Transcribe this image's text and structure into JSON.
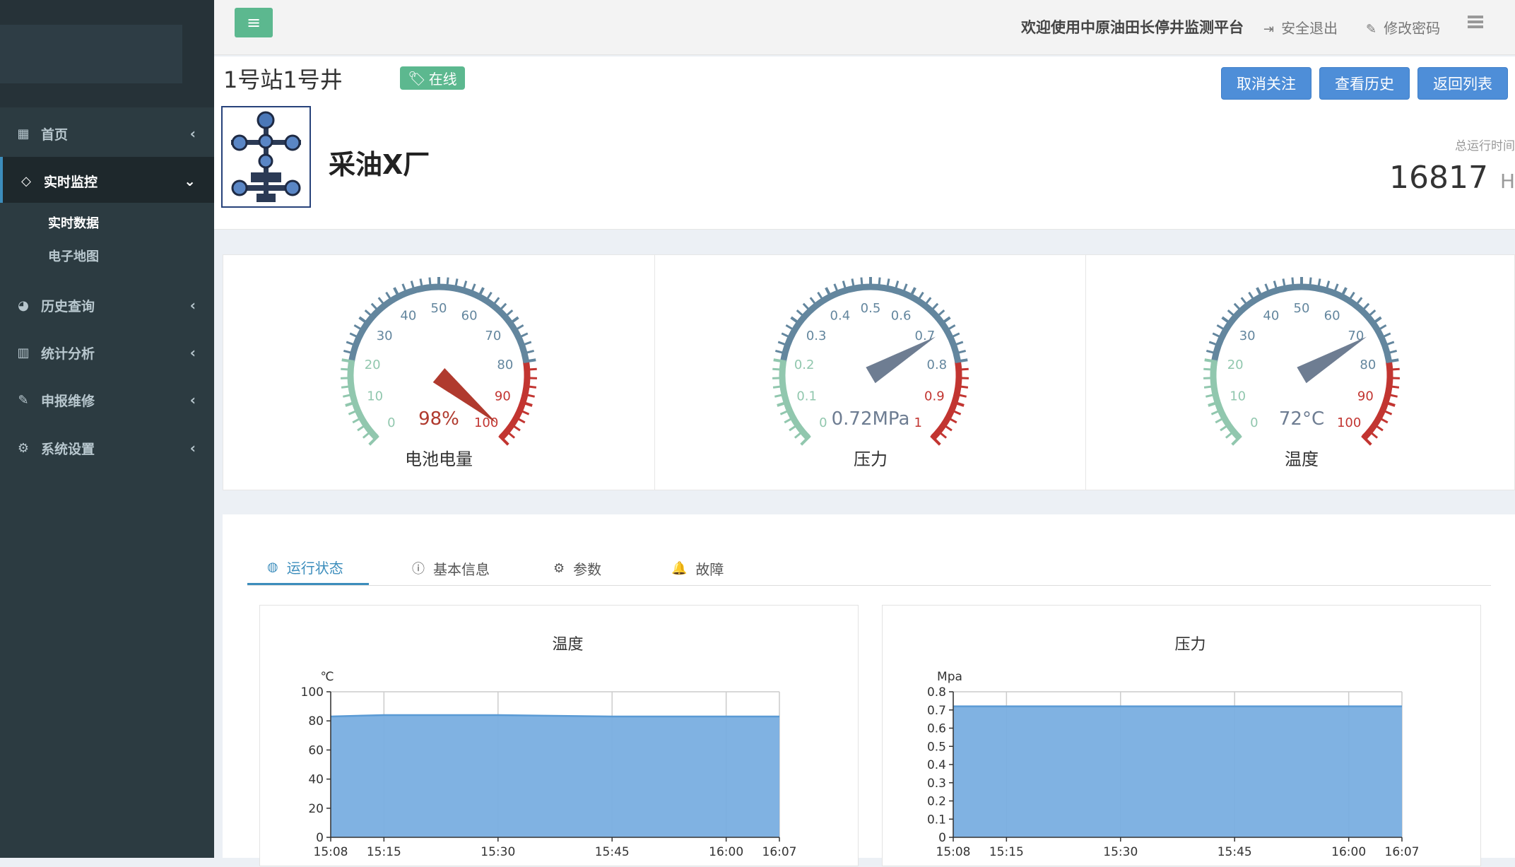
{
  "sidebar": {
    "items": [
      {
        "label": "首页",
        "icon": "dashboard-icon"
      },
      {
        "label": "实时监控",
        "icon": "diamond-icon"
      },
      {
        "label": "历史查询",
        "icon": "pie-chart-icon"
      },
      {
        "label": "统计分析",
        "icon": "bar-chart-icon"
      },
      {
        "label": "申报维修",
        "icon": "edit-icon"
      },
      {
        "label": "系统设置",
        "icon": "gear-icon"
      }
    ],
    "subitems": [
      "实时数据",
      "电子地图"
    ]
  },
  "topbar": {
    "welcome": "欢迎使用中原油田长停井监测平台",
    "logout": "安全退出",
    "change_password": "修改密码"
  },
  "well": {
    "title": "1号站1号井",
    "status": "在线",
    "factory": "采油X厂",
    "runtime_label": "总运行时间",
    "runtime_value": "16817",
    "runtime_unit": "H"
  },
  "actions": {
    "unfollow": "取消关注",
    "history": "查看历史",
    "back": "返回列表"
  },
  "gauges": [
    {
      "name": "电池电量",
      "value": 98,
      "display": "98%",
      "min": 0,
      "max": 100,
      "ticks": [
        "0",
        "10",
        "20",
        "30",
        "40",
        "50",
        "60",
        "70",
        "80",
        "90",
        "100"
      ],
      "value_color": "#b03a2e"
    },
    {
      "name": "压力",
      "value": 0.72,
      "display": "0.72MPa",
      "min": 0,
      "max": 1,
      "ticks": [
        "0",
        "0.1",
        "0.2",
        "0.3",
        "0.4",
        "0.5",
        "0.6",
        "0.7",
        "0.8",
        "0.9",
        "1"
      ],
      "value_color": "#6e7d92"
    },
    {
      "name": "温度",
      "value": 72,
      "display": "72°C",
      "min": 0,
      "max": 100,
      "ticks": [
        "0",
        "10",
        "20",
        "30",
        "40",
        "50",
        "60",
        "70",
        "80",
        "90",
        "100"
      ],
      "value_color": "#6e7d92"
    }
  ],
  "gauge_colors": {
    "low": "#91c7ae",
    "mid": "#63869e",
    "high": "#c23531"
  },
  "tabs": [
    {
      "label": "运行状态",
      "icon": "dashboard-icon"
    },
    {
      "label": "基本信息",
      "icon": "info-icon"
    },
    {
      "label": "参数",
      "icon": "gears-icon"
    },
    {
      "label": "故障",
      "icon": "bell-icon"
    }
  ],
  "chart_data": [
    {
      "type": "area",
      "title": "温度",
      "ylabel": "℃",
      "xlabel": "",
      "ylim": [
        0,
        100
      ],
      "yticks": [
        "0",
        "20",
        "40",
        "60",
        "80",
        "100"
      ],
      "xtick_labels": [
        "15:08",
        "15:15",
        "15:30",
        "15:45",
        "16:00",
        "16:07"
      ],
      "x": [
        "15:08",
        "15:15",
        "15:30",
        "15:45",
        "16:00",
        "16:07"
      ],
      "series": [
        {
          "values": [
            83,
            84,
            84,
            83,
            83,
            83
          ]
        }
      ],
      "color": "#79aee0",
      "line_color": "#5b9bd5"
    },
    {
      "type": "area",
      "title": "压力",
      "ylabel": "Mpa",
      "xlabel": "",
      "ylim": [
        0,
        0.8
      ],
      "yticks": [
        "0",
        "0.1",
        "0.2",
        "0.3",
        "0.4",
        "0.5",
        "0.6",
        "0.7",
        "0.8"
      ],
      "xtick_labels": [
        "15:08",
        "15:15",
        "15:30",
        "15:45",
        "16:00",
        "16:07"
      ],
      "x": [
        "15:08",
        "15:15",
        "15:30",
        "15:45",
        "16:00",
        "16:07"
      ],
      "series": [
        {
          "values": [
            0.72,
            0.72,
            0.72,
            0.72,
            0.72,
            0.72
          ]
        }
      ],
      "color": "#79aee0",
      "line_color": "#5b9bd5"
    }
  ]
}
